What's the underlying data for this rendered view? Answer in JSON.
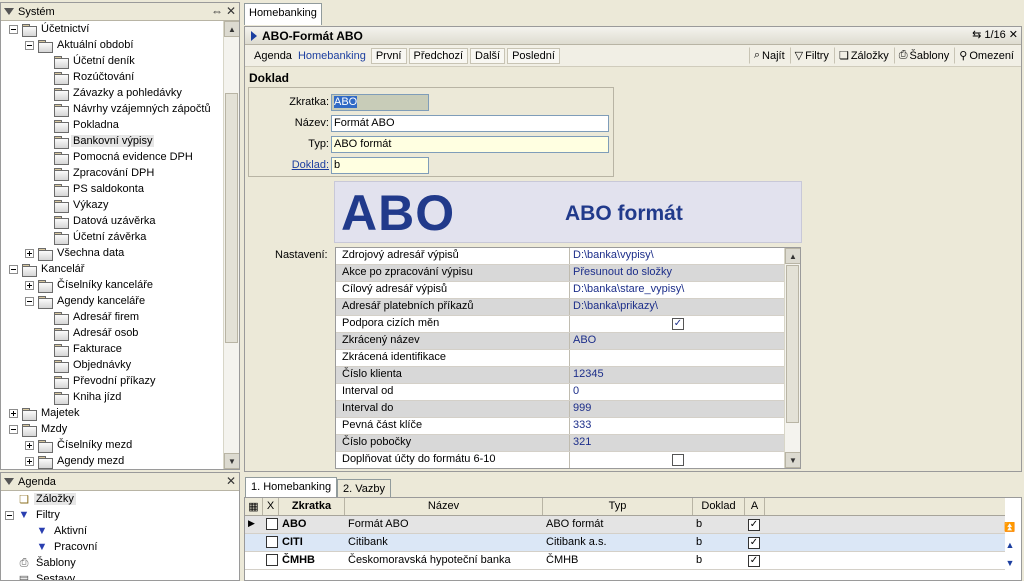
{
  "system_panel": {
    "title": "Systém",
    "tree": [
      {
        "label": "Účetnictví",
        "level": 1,
        "expander": "minus"
      },
      {
        "label": "Aktuální období",
        "level": 2,
        "expander": "minus"
      },
      {
        "label": "Účetní deník",
        "level": 3,
        "expander": ""
      },
      {
        "label": "Rozúčtování",
        "level": 3,
        "expander": ""
      },
      {
        "label": "Závazky a pohledávky",
        "level": 3,
        "expander": ""
      },
      {
        "label": "Návrhy vzájemných zápočtů",
        "level": 3,
        "expander": ""
      },
      {
        "label": "Pokladna",
        "level": 3,
        "expander": ""
      },
      {
        "label": "Bankovní výpisy",
        "level": 3,
        "expander": "",
        "selected": true
      },
      {
        "label": "Pomocná evidence DPH",
        "level": 3,
        "expander": ""
      },
      {
        "label": "Zpracování DPH",
        "level": 3,
        "expander": ""
      },
      {
        "label": "PS saldokonta",
        "level": 3,
        "expander": ""
      },
      {
        "label": "Výkazy",
        "level": 3,
        "expander": ""
      },
      {
        "label": "Datová uzávěrka",
        "level": 3,
        "expander": ""
      },
      {
        "label": "Účetní závěrka",
        "level": 3,
        "expander": ""
      },
      {
        "label": "Všechna data",
        "level": 2,
        "expander": "plus"
      },
      {
        "label": "Kancelář",
        "level": 1,
        "expander": "minus"
      },
      {
        "label": "Číselníky kanceláře",
        "level": 2,
        "expander": "plus"
      },
      {
        "label": "Agendy kanceláře",
        "level": 2,
        "expander": "minus"
      },
      {
        "label": "Adresář firem",
        "level": 3,
        "expander": ""
      },
      {
        "label": "Adresář osob",
        "level": 3,
        "expander": ""
      },
      {
        "label": "Fakturace",
        "level": 3,
        "expander": ""
      },
      {
        "label": "Objednávky",
        "level": 3,
        "expander": ""
      },
      {
        "label": "Převodní příkazy",
        "level": 3,
        "expander": ""
      },
      {
        "label": "Kniha jízd",
        "level": 3,
        "expander": ""
      },
      {
        "label": "Majetek",
        "level": 1,
        "expander": "plus"
      },
      {
        "label": "Mzdy",
        "level": 1,
        "expander": "minus"
      },
      {
        "label": "Číselníky mezd",
        "level": 2,
        "expander": "plus"
      },
      {
        "label": "Agendy mezd",
        "level": 2,
        "expander": "plus"
      }
    ]
  },
  "agenda_panel": {
    "title": "Agenda",
    "items": [
      {
        "label": "Záložky",
        "level": 1,
        "icon": "bookmark-icon",
        "selected": true
      },
      {
        "label": "Filtry",
        "level": 1,
        "icon": "filter-icon",
        "expander": "minus"
      },
      {
        "label": "Aktivní",
        "level": 2,
        "icon": "filter-icon"
      },
      {
        "label": "Pracovní",
        "level": 2,
        "icon": "filter-icon"
      },
      {
        "label": "Šablony",
        "level": 1,
        "icon": "template-icon"
      },
      {
        "label": "Sestavy",
        "level": 1,
        "icon": "report-icon"
      }
    ]
  },
  "tabs": {
    "main": "Homebanking"
  },
  "window": {
    "title": "ABO-Formát ABO",
    "page": "1/16",
    "toolbar": {
      "agenda_label": "Agenda",
      "agenda_value": "Homebanking",
      "first": "První",
      "prev": "Předchozí",
      "next": "Další",
      "last": "Poslední",
      "find": "Najít",
      "filters": "Filtry",
      "bookmarks": "Záložky",
      "templates": "Šablony",
      "restrictions": "Omezení"
    }
  },
  "doklad": {
    "section": "Doklad",
    "zkratka_label": "Zkratka:",
    "zkratka": "ABO",
    "nazev_label": "Název:",
    "nazev": "Formát ABO",
    "typ_label": "Typ:",
    "typ": "ABO formát",
    "doklad_label": "Doklad:",
    "doklad": "b"
  },
  "logo": {
    "big": "ABO",
    "small": "ABO formát"
  },
  "settings": {
    "label": "Nastavení:",
    "rows": [
      {
        "key": "Zdrojový adresář výpisů",
        "value": "D:\\banka\\vypisy\\"
      },
      {
        "key": "Akce po zpracování výpisu",
        "value": "Přesunout do složky"
      },
      {
        "key": "Cílový adresář výpisů",
        "value": "D:\\banka\\stare_vypisy\\"
      },
      {
        "key": "Adresář platebních příkazů",
        "value": "D:\\banka\\prikazy\\"
      },
      {
        "key": "Podpora cizích měn",
        "value": "",
        "checkbox": true,
        "checked": true
      },
      {
        "key": "Zkrácený název",
        "value": "ABO"
      },
      {
        "key": "Zkrácená identifikace",
        "value": ""
      },
      {
        "key": "Číslo klienta",
        "value": "12345"
      },
      {
        "key": "Interval od",
        "value": "0"
      },
      {
        "key": "Interval do",
        "value": "999"
      },
      {
        "key": "Pevná část klíče",
        "value": "333"
      },
      {
        "key": "Číslo pobočky",
        "value": "321"
      },
      {
        "key": "Doplňovat účty do formátu 6-10",
        "value": "",
        "checkbox": true,
        "checked": false
      }
    ]
  },
  "bottom": {
    "tabs": [
      "1. Homebanking",
      "2. Vazby"
    ],
    "columns": [
      "X",
      "Zkratka",
      "Název",
      "Typ",
      "Doklad",
      "A"
    ],
    "rows": [
      {
        "zkratka": "ABO",
        "nazev": "Formát ABO",
        "typ": "ABO formát",
        "doklad": "b",
        "a": true
      },
      {
        "zkratka": "CITI",
        "nazev": "Citibank",
        "typ": "Citibank a.s.",
        "doklad": "b",
        "a": true
      },
      {
        "zkratka": "ČMHB",
        "nazev": "Českomoravská hypoteční banka",
        "typ": "ČMHB",
        "doklad": "b",
        "a": true
      }
    ]
  },
  "colors": {
    "accent": "#213a8b",
    "logo_bg": "#e2e2ee",
    "input_yellow": "#ffffe1",
    "selection_blue": "#dbe7f6"
  }
}
